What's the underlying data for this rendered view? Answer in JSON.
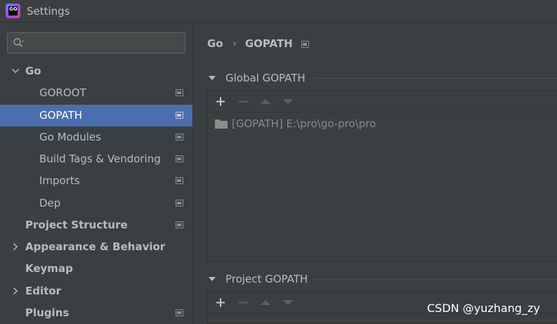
{
  "window": {
    "title": "Settings",
    "logo_text": "GO"
  },
  "sidebar": {
    "search": {
      "placeholder": "",
      "value": ""
    },
    "items": [
      {
        "label": "Go",
        "bold": true,
        "expanded": true,
        "level": 0,
        "has_project_icon": false
      },
      {
        "label": "GOROOT",
        "level": 1,
        "has_project_icon": true
      },
      {
        "label": "GOPATH",
        "level": 1,
        "selected": true,
        "has_project_icon": true
      },
      {
        "label": "Go Modules",
        "level": 1,
        "has_project_icon": true
      },
      {
        "label": "Build Tags & Vendoring",
        "level": 1,
        "has_project_icon": true
      },
      {
        "label": "Imports",
        "level": 1,
        "has_project_icon": true
      },
      {
        "label": "Dep",
        "level": 1,
        "has_project_icon": true
      },
      {
        "label": "Project Structure",
        "bold": true,
        "level": 0,
        "has_project_icon": true
      },
      {
        "label": "Appearance & Behavior",
        "bold": true,
        "collapsed": true,
        "level": 0,
        "has_project_icon": false
      },
      {
        "label": "Keymap",
        "bold": true,
        "level": 0,
        "has_project_icon": false
      },
      {
        "label": "Editor",
        "bold": true,
        "collapsed": true,
        "level": 0,
        "has_project_icon": false
      },
      {
        "label": "Plugins",
        "bold": true,
        "level": 0,
        "has_project_icon": true
      }
    ]
  },
  "main": {
    "breadcrumb": {
      "parent": "Go",
      "separator": "›",
      "current": "GOPATH"
    },
    "global_gopath": {
      "header": "Global GOPATH",
      "toolbar": {
        "add": "+",
        "remove": "−",
        "up": "▲",
        "down": "▼"
      },
      "entries": [
        "[GOPATH] E:\\pro\\go-pro\\pro"
      ]
    },
    "project_gopath": {
      "header": "Project GOPATH",
      "toolbar": {
        "add": "+",
        "remove": "−",
        "up": "▲",
        "down": "▼"
      },
      "entries": []
    }
  },
  "watermark": "CSDN @yuzhang_zy",
  "colors": {
    "background": "#3c3f41",
    "selection": "#4b6eaf",
    "text": "#bbbbbb",
    "muted_text": "#8a8a8a",
    "border": "#323232"
  }
}
